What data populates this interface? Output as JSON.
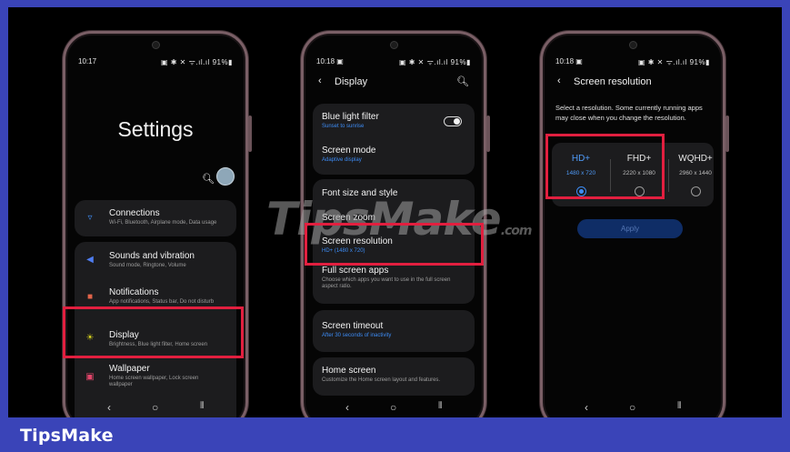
{
  "footer": {
    "brand": "TipsMake"
  },
  "watermark": {
    "text": "TipsMake",
    "suffix": ".com"
  },
  "colors": {
    "accent_blue": "#3d8cf5",
    "highlight_red": "#e21f3f",
    "band": "#3a44b8"
  },
  "phone1": {
    "time": "10:17",
    "status_icons": "▣ ✱ ✕ ᯤ.ıl.ıl 91%▮",
    "title": "Settings",
    "items": [
      {
        "title": "Connections",
        "subtitle": "Wi-Fi, Bluetooth, Airplane mode, Data usage",
        "icon": "wifi-icon"
      },
      {
        "title": "Sounds and vibration",
        "subtitle": "Sound mode, Ringtone, Volume",
        "icon": "sound-icon"
      },
      {
        "title": "Notifications",
        "subtitle": "App notifications, Status bar, Do not disturb",
        "icon": "notification-icon"
      },
      {
        "title": "Display",
        "subtitle": "Brightness, Blue light filter, Home screen",
        "icon": "brightness-icon"
      },
      {
        "title": "Wallpaper",
        "subtitle": "Home screen wallpaper, Lock screen wallpaper",
        "icon": "wallpaper-icon"
      }
    ]
  },
  "phone2": {
    "time": "10:18 ▣",
    "status_icons": "▣ ✱ ✕ ᯤ.ıl.ıl 91%▮",
    "header": "Display",
    "items": [
      {
        "title": "Blue light filter",
        "subtitle": "Sunset to sunrise"
      },
      {
        "title": "Screen mode",
        "subtitle": "Adaptive display"
      },
      {
        "title": "Font size and style",
        "subtitle": ""
      },
      {
        "title": "Screen zoom",
        "subtitle": ""
      },
      {
        "title": "Screen resolution",
        "subtitle": "HD+ (1480 x 720)"
      },
      {
        "title": "Full screen apps",
        "subtitle": "Choose which apps you want to use in the full screen aspect ratio."
      },
      {
        "title": "Screen timeout",
        "subtitle": "After 30 seconds of inactivity"
      },
      {
        "title": "Home screen",
        "subtitle": "Customize the Home screen layout and features."
      }
    ]
  },
  "phone3": {
    "time": "10:18 ▣",
    "status_icons": "▣ ✱ ✕ ᯤ.ıl.ıl 91%▮",
    "header": "Screen resolution",
    "description": "Select a resolution. Some currently running apps may close when you change the resolution.",
    "options": [
      {
        "name": "HD+",
        "dims": "1480 x 720",
        "selected": true
      },
      {
        "name": "FHD+",
        "dims": "2220 x 1080",
        "selected": false
      },
      {
        "name": "WQHD+",
        "dims": "2960 x 1440",
        "selected": false
      }
    ],
    "apply_label": "Apply"
  },
  "navbar": {
    "back": "‹",
    "home": "○",
    "recents": "⦀"
  }
}
